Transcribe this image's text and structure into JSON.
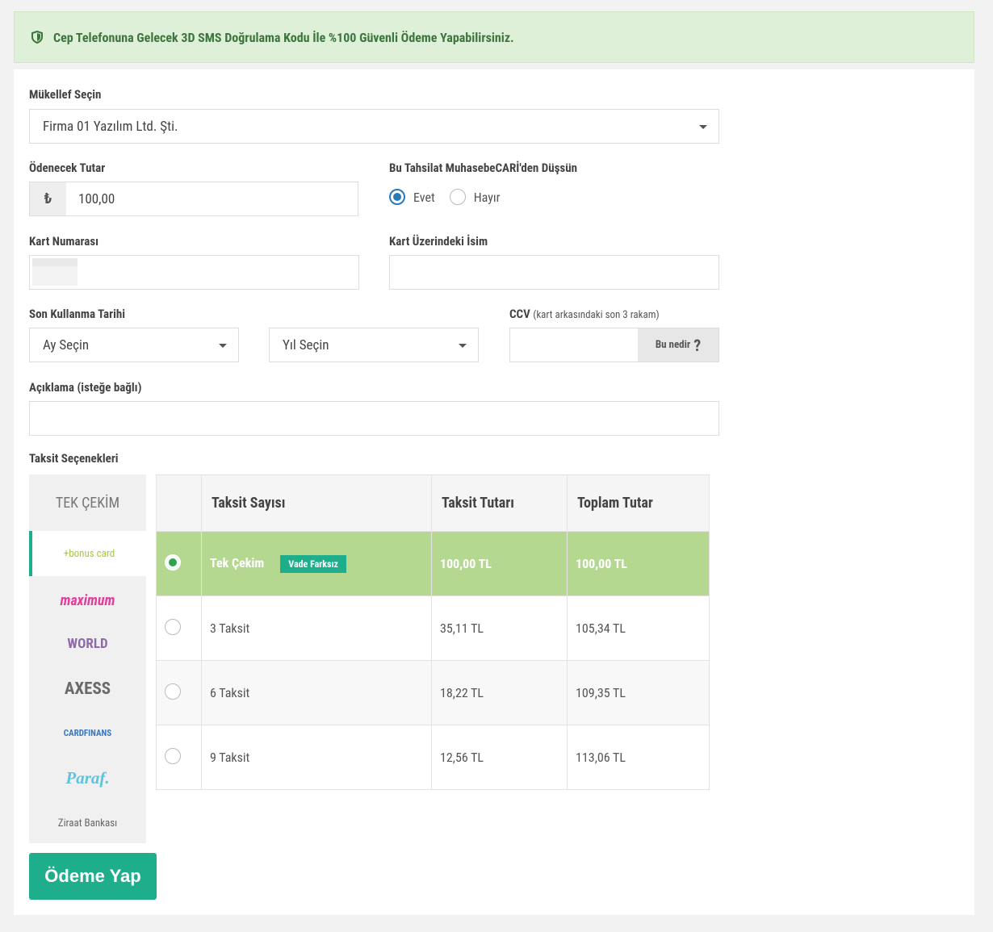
{
  "alert": {
    "text": "Cep Telefonuna Gelecek 3D SMS Doğrulama Kodu İle %100 Güvenli Ödeme Yapabilirsiniz."
  },
  "mukellef": {
    "label": "Mükellef Seçin",
    "value": "Firma 01 Yazılım Ltd. Şti."
  },
  "tutar": {
    "label": "Ödenecek Tutar",
    "currency": "₺",
    "value": "100,00"
  },
  "tahsilat": {
    "label": "Bu Tahsilat MuhasebeCARİ'den Düşsün",
    "yes": "Evet",
    "no": "Hayır"
  },
  "kart_no": {
    "label": "Kart Numarası"
  },
  "kart_isim": {
    "label": "Kart Üzerindeki İsim"
  },
  "son_kullanma": {
    "label": "Son Kullanma Tarihi",
    "month": "Ay Seçin",
    "year": "Yıl Seçin"
  },
  "ccv": {
    "label": "CCV",
    "hint": "(kart arkasındaki son 3 rakam)",
    "button": "Bu nedir",
    "q": "?"
  },
  "aciklama": {
    "label": "Açıklama (isteğe bağlı)"
  },
  "taksit": {
    "label": "Taksit Seçenekleri",
    "tek_cekim_tab": "TEK ÇEKİM",
    "banks": [
      "+bonus card",
      "maximum",
      "WORLD",
      "AXESS",
      "CARDFINANS",
      "Paraf.",
      "Ziraat Bankası"
    ],
    "headers": [
      "Taksit Sayısı",
      "Taksit Tutarı",
      "Toplam Tutar"
    ],
    "rows": [
      {
        "name": "Tek Çekim",
        "tag": "Vade Farksız",
        "installment": "100,00 TL",
        "total": "100,00 TL"
      },
      {
        "name": "3 Taksit",
        "installment": "35,11 TL",
        "total": "105,34 TL"
      },
      {
        "name": "6 Taksit",
        "installment": "18,22 TL",
        "total": "109,35 TL"
      },
      {
        "name": "9 Taksit",
        "installment": "12,56 TL",
        "total": "113,06 TL"
      }
    ]
  },
  "pay_button": "Ödeme Yap"
}
